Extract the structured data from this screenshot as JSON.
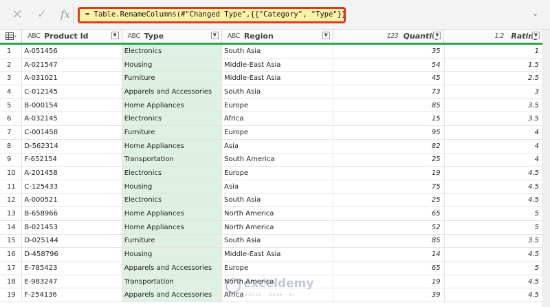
{
  "formula_bar": {
    "cancel_icon": "x-icon",
    "confirm_icon": "check-icon",
    "fx_label": "fx",
    "formula": "= Table.RenameColumns(#\"Changed Type\",{{\"Category\", \"Type\"}})",
    "highlight_color": "#fff2a8",
    "border_color": "#e03a1e"
  },
  "columns": [
    {
      "type_icon": "ABC",
      "label": "Product Id"
    },
    {
      "type_icon": "ABC",
      "label": "Type"
    },
    {
      "type_icon": "ABC",
      "label": "Region"
    },
    {
      "type_icon": "123",
      "label": "Quantity"
    },
    {
      "type_icon": "1.2",
      "label": "Rating"
    }
  ],
  "rows": [
    {
      "n": "1",
      "id": "A-051456",
      "type": "Electronics",
      "region": "South Asia",
      "qty": "35",
      "rating": "1"
    },
    {
      "n": "2",
      "id": "A-021547",
      "type": "Housing",
      "region": "Middle-East Asia",
      "qty": "54",
      "rating": "1.5"
    },
    {
      "n": "3",
      "id": "A-031021",
      "type": "Furniture",
      "region": "Middle-East Asia",
      "qty": "45",
      "rating": "2.5"
    },
    {
      "n": "4",
      "id": "C-012145",
      "type": "Apparels and Accessories",
      "region": "South Asia",
      "qty": "73",
      "rating": "3"
    },
    {
      "n": "5",
      "id": "B-000154",
      "type": "Home Appliances",
      "region": "Europe",
      "qty": "85",
      "rating": "3.5"
    },
    {
      "n": "6",
      "id": "A-032145",
      "type": "Electronics",
      "region": "Africa",
      "qty": "15",
      "rating": "3.5"
    },
    {
      "n": "7",
      "id": "C-001458",
      "type": "Furniture",
      "region": "Europe",
      "qty": "95",
      "rating": "4"
    },
    {
      "n": "8",
      "id": "D-562314",
      "type": "Home Appliances",
      "region": "Asia",
      "qty": "82",
      "rating": "4"
    },
    {
      "n": "9",
      "id": "F-652154",
      "type": "Transportation",
      "region": "South America",
      "qty": "25",
      "rating": "4"
    },
    {
      "n": "10",
      "id": "A-201458",
      "type": "Electronics",
      "region": "Europe",
      "qty": "19",
      "rating": "4.5"
    },
    {
      "n": "11",
      "id": "C-125433",
      "type": "Housing",
      "region": "Asia",
      "qty": "75",
      "rating": "4.5"
    },
    {
      "n": "12",
      "id": "A-000521",
      "type": "Electronics",
      "region": "South Asia",
      "qty": "25",
      "rating": "4.5"
    },
    {
      "n": "13",
      "id": "B-658966",
      "type": "Home Appliances",
      "region": "North America",
      "qty": "65",
      "rating": "5"
    },
    {
      "n": "14",
      "id": "B-021453",
      "type": "Home Appliances",
      "region": "North America",
      "qty": "52",
      "rating": "5"
    },
    {
      "n": "15",
      "id": "D-025144",
      "type": "Furniture",
      "region": "South Asia",
      "qty": "85",
      "rating": "3.5"
    },
    {
      "n": "16",
      "id": "D-458796",
      "type": "Housing",
      "region": "Middle-East Asia",
      "qty": "14",
      "rating": "4.5"
    },
    {
      "n": "17",
      "id": "E-785423",
      "type": "Apparels and Accessories",
      "region": "Europe",
      "qty": "65",
      "rating": "5"
    },
    {
      "n": "18",
      "id": "E-983247",
      "type": "Transportation",
      "region": "North America",
      "qty": "19",
      "rating": "4.5"
    },
    {
      "n": "19",
      "id": "F-254136",
      "type": "Apparels and Accessories",
      "region": "Africa",
      "qty": "39",
      "rating": "4.5"
    }
  ],
  "watermark": {
    "name": "exceldemy",
    "tagline": "EXCEL · DATA · BI"
  }
}
